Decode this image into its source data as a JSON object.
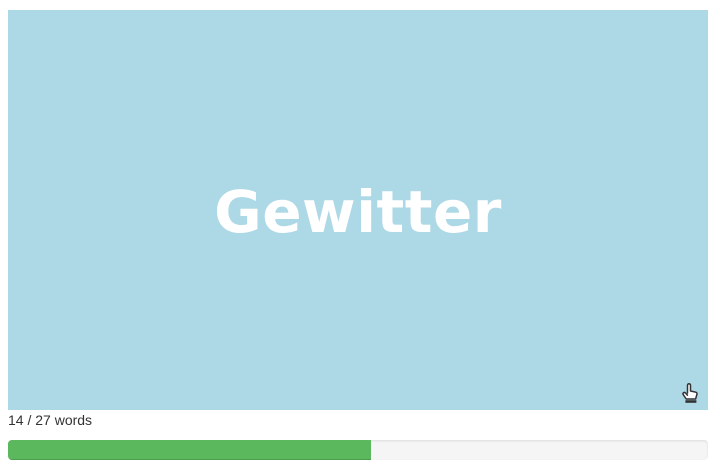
{
  "flashcard": {
    "word": "Gewitter",
    "background_color": "#add8e6",
    "text_color": "#ffffff",
    "icon": "tap-hand-icon"
  },
  "progress": {
    "current": 14,
    "total": 27,
    "label": "14 / 27 words",
    "fill_color": "#5cb85c",
    "track_color": "#f5f5f5"
  }
}
